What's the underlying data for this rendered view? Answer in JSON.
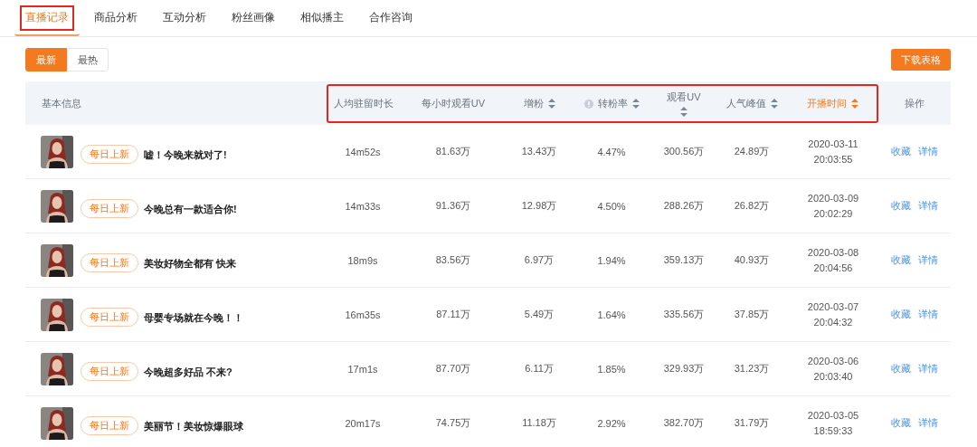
{
  "tabs": [
    {
      "label": "直播记录",
      "selected": true,
      "highlighted": true
    },
    {
      "label": "商品分析",
      "selected": false,
      "highlighted": false
    },
    {
      "label": "互动分析",
      "selected": false,
      "highlighted": false
    },
    {
      "label": "粉丝画像",
      "selected": false,
      "highlighted": false
    },
    {
      "label": "相似播主",
      "selected": false,
      "highlighted": false
    },
    {
      "label": "合作咨询",
      "selected": false,
      "highlighted": false
    }
  ],
  "sort_toggle": [
    {
      "label": "最新",
      "selected": true
    },
    {
      "label": "最热",
      "selected": false
    }
  ],
  "download_button": "下载表格",
  "table": {
    "columns": [
      {
        "label": "基本信息",
        "highlighted": false,
        "sortable": false,
        "selected": false,
        "info": false
      },
      {
        "label": "人均驻留时长",
        "highlighted": true,
        "sortable": false,
        "selected": false,
        "info": false
      },
      {
        "label": "每小时观看UV",
        "highlighted": true,
        "sortable": false,
        "selected": false,
        "info": false
      },
      {
        "label": "增粉",
        "highlighted": true,
        "sortable": true,
        "selected": false,
        "info": false
      },
      {
        "label": "转粉率",
        "highlighted": true,
        "sortable": true,
        "selected": false,
        "info": true
      },
      {
        "label": "观看UV",
        "highlighted": true,
        "sortable": true,
        "selected": false,
        "info": false
      },
      {
        "label": "人气峰值",
        "highlighted": true,
        "sortable": true,
        "selected": false,
        "info": false
      },
      {
        "label": "开播时间",
        "highlighted": true,
        "sortable": true,
        "selected": true,
        "info": false
      },
      {
        "label": "操作",
        "highlighted": false,
        "sortable": false,
        "selected": false,
        "info": false
      }
    ],
    "rows": [
      {
        "badge": "每日上新",
        "title": "嘘！今晚来就对了!",
        "stay": "14m52s",
        "hourly_uv": "81.63万",
        "fans_gain": "13.43万",
        "conversion": "4.47%",
        "uv": "300.56万",
        "peak": "24.89万",
        "date": "2020-03-11",
        "time": "20:03:55",
        "actions": [
          "收藏",
          "详情"
        ]
      },
      {
        "badge": "每日上新",
        "title": "今晚总有一款适合你!",
        "stay": "14m33s",
        "hourly_uv": "91.36万",
        "fans_gain": "12.98万",
        "conversion": "4.50%",
        "uv": "288.26万",
        "peak": "26.82万",
        "date": "2020-03-09",
        "time": "20:02:29",
        "actions": [
          "收藏",
          "详情"
        ]
      },
      {
        "badge": "每日上新",
        "title": "美妆好物全都有 快来",
        "stay": "18m9s",
        "hourly_uv": "83.56万",
        "fans_gain": "6.97万",
        "conversion": "1.94%",
        "uv": "359.13万",
        "peak": "40.93万",
        "date": "2020-03-08",
        "time": "20:04:56",
        "actions": [
          "收藏",
          "详情"
        ]
      },
      {
        "badge": "每日上新",
        "title": "母婴专场就在今晚！！",
        "stay": "16m35s",
        "hourly_uv": "87.11万",
        "fans_gain": "5.49万",
        "conversion": "1.64%",
        "uv": "335.56万",
        "peak": "37.85万",
        "date": "2020-03-07",
        "time": "20:04:32",
        "actions": [
          "收藏",
          "详情"
        ]
      },
      {
        "badge": "每日上新",
        "title": "今晚超多好品 不来?",
        "stay": "17m1s",
        "hourly_uv": "87.70万",
        "fans_gain": "6.11万",
        "conversion": "1.85%",
        "uv": "329.93万",
        "peak": "31.23万",
        "date": "2020-03-06",
        "time": "20:03:40",
        "actions": [
          "收藏",
          "详情"
        ]
      },
      {
        "badge": "每日上新",
        "title": "美丽节！美妆惊爆眼球",
        "stay": "20m17s",
        "hourly_uv": "74.75万",
        "fans_gain": "11.18万",
        "conversion": "2.92%",
        "uv": "382.70万",
        "peak": "31.79万",
        "date": "2020-03-05",
        "time": "18:59:33",
        "actions": [
          "收藏",
          "详情"
        ]
      }
    ]
  }
}
